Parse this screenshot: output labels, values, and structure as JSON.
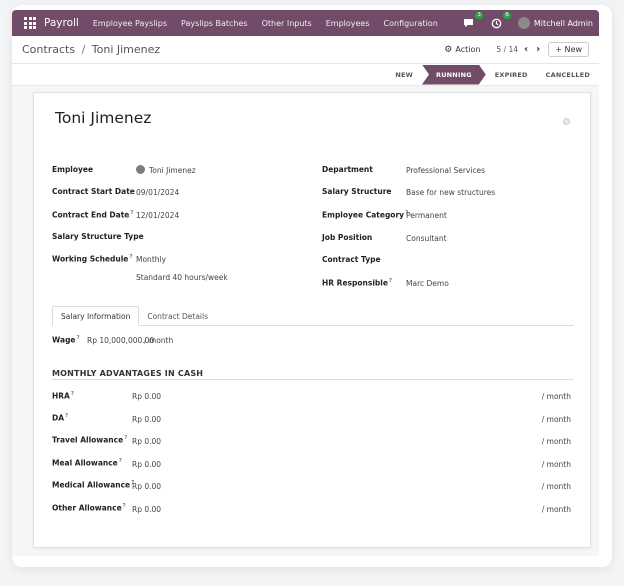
{
  "nav": {
    "brand": "Payroll",
    "menu": [
      "Employee Payslips",
      "Payslips Batches",
      "Other Inputs",
      "Employees",
      "Configuration"
    ],
    "chat_count": "3",
    "activity_count": "6",
    "user_name": "Mitchell Admin"
  },
  "breadcrumb": {
    "parent": "Contracts",
    "separator": "/",
    "current": "Toni Jimenez"
  },
  "control": {
    "action_label": "Action",
    "pager": "5 / 14",
    "prev_icon": "‹",
    "next_icon": "›",
    "new_label": "+ New"
  },
  "status_stages": [
    "NEW",
    "RUNNING",
    "EXPIRED",
    "CANCELLED"
  ],
  "active_stage": "RUNNING",
  "form": {
    "title": "Toni Jimenez",
    "left_fields": [
      {
        "label": "Employee",
        "value": "Toni Jimenez"
      },
      {
        "label": "Contract Start Date",
        "value": "09/01/2024"
      },
      {
        "label": "Contract End Date",
        "value": "12/01/2024"
      },
      {
        "label": "Salary Structure Type",
        "value": ""
      },
      {
        "label": "Working Schedule",
        "value": "Monthly",
        "value2": "Standard 40 hours/week"
      }
    ],
    "right_fields": [
      {
        "label": "Department",
        "value": "Professional Services"
      },
      {
        "label": "Salary Structure",
        "value": "Base for new structures"
      },
      {
        "label": "Employee Category",
        "value": "Permanent"
      },
      {
        "label": "Job Position",
        "value": "Consultant"
      },
      {
        "label": "Contract Type",
        "value": ""
      },
      {
        "label": "HR Responsible",
        "value": "Marc Demo"
      }
    ],
    "help_mark": "?"
  },
  "tabs": [
    "Salary Information",
    "Contract Details"
  ],
  "wage": {
    "label": "Wage",
    "value": "Rp 10,000,000.00",
    "suffix": "/ month"
  },
  "advantages": {
    "title": "MONTHLY ADVANTAGES IN CASH",
    "suffix": "/ month",
    "rows": [
      {
        "label": "HRA",
        "value": "Rp 0.00"
      },
      {
        "label": "DA",
        "value": "Rp 0.00"
      },
      {
        "label": "Travel Allowance",
        "value": "Rp 0.00"
      },
      {
        "label": "Meal Allowance",
        "value": "Rp 0.00"
      },
      {
        "label": "Medical Allowance",
        "value": "Rp 0.00"
      },
      {
        "label": "Other Allowance",
        "value": "Rp 0.00"
      }
    ]
  },
  "colors": {
    "brand": "#714b67",
    "badge": "#28a745"
  }
}
